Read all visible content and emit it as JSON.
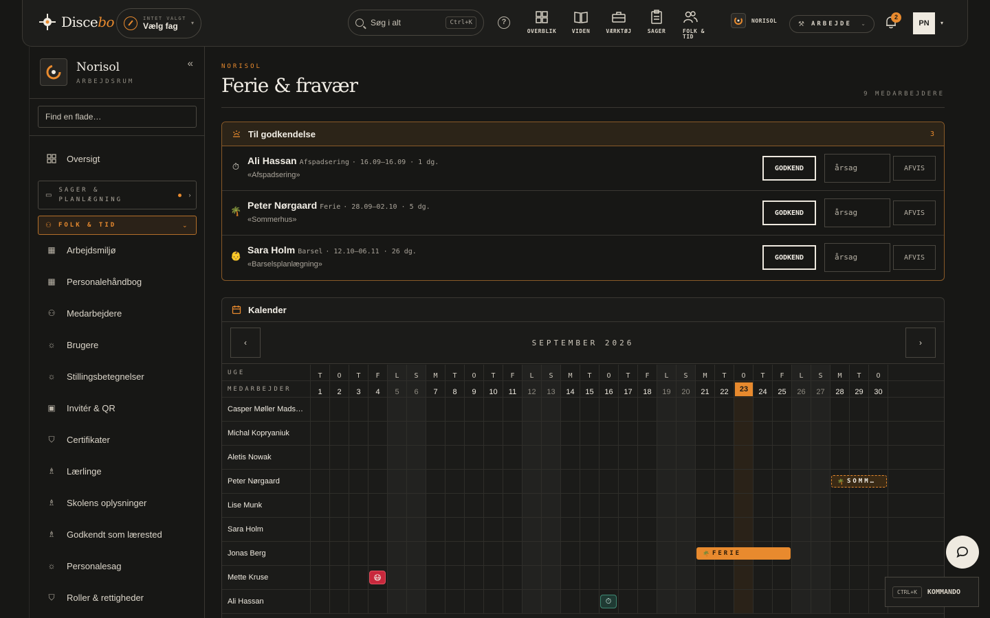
{
  "brand": {
    "name_a": "Disce",
    "name_b": "bo"
  },
  "fag_picker": {
    "eyebrow": "INTET VALGT",
    "label": "Vælg fag"
  },
  "search": {
    "placeholder": "Søg i alt",
    "shortcut": "Ctrl+K"
  },
  "nav": [
    {
      "label": "OVERBLIK",
      "icon": "grid-icon"
    },
    {
      "label": "VIDEN",
      "icon": "book-icon"
    },
    {
      "label": "VÆRKTØJ",
      "icon": "briefcase-icon"
    },
    {
      "label": "SAGER",
      "icon": "clipboard-icon"
    },
    {
      "label": "FOLK & TID",
      "icon": "people-icon"
    }
  ],
  "workspace_chip": "NORISOL",
  "role": "ARBEJDE",
  "notifications": "2",
  "user_initials": "PN",
  "sidebar": {
    "workspace": "Norisol",
    "workspace_sub": "ARBEJDSRUM",
    "find_placeholder": "Find en flade…",
    "overview": "Oversigt",
    "group_sager": "SAGER & PLANLÆGNING",
    "group_folk": "FOLK & TID",
    "items": [
      {
        "label": "Arbejdsmiljø",
        "icon": "grid-icon"
      },
      {
        "label": "Personalehåndbog",
        "icon": "grid-icon"
      },
      {
        "label": "Medarbejdere",
        "icon": "people-icon"
      },
      {
        "label": "Brugere",
        "icon": "sun-icon"
      },
      {
        "label": "Stillingsbetegnelser",
        "icon": "sun-icon"
      },
      {
        "label": "Invitér & QR",
        "icon": "qr-icon"
      },
      {
        "label": "Certifikater",
        "icon": "shield-icon"
      },
      {
        "label": "Lærlinge",
        "icon": "award-icon"
      },
      {
        "label": "Skolens oplysninger",
        "icon": "award-icon"
      },
      {
        "label": "Godkendt som lærested",
        "icon": "award-icon"
      },
      {
        "label": "Personalesag",
        "icon": "sun-icon"
      },
      {
        "label": "Roller & rettigheder",
        "icon": "shield-icon"
      }
    ]
  },
  "page": {
    "eyebrow": "NORISOL",
    "title": "Ferie & fravær",
    "count": "9 MEDARBEJDERE"
  },
  "approvals": {
    "title": "Til godkendelse",
    "count": "3",
    "approve_label": "GODKEND",
    "reason_placeholder": "årsag",
    "reject_label": "AFVIS",
    "requests": [
      {
        "name": "Ali Hassan",
        "type": "Afspadsering",
        "meta": "· 16.09–16.09 · 1 dg.",
        "note": "«Afspadsering»",
        "icon": "⏱"
      },
      {
        "name": "Peter Nørgaard",
        "type": "Ferie",
        "meta": "· 28.09–02.10 · 5 dg.",
        "note": "«Sommerhus»",
        "icon": "🌴"
      },
      {
        "name": "Sara Holm",
        "type": "Barsel",
        "meta": "· 12.10–06.11 · 26 dg.",
        "note": "«Barselsplanlægning»",
        "icon": "👶"
      }
    ]
  },
  "calendar": {
    "title": "Kalender",
    "month": "SEPTEMBER 2026",
    "week_label": "UGE",
    "employee_label": "MEDARBEJDER",
    "weekdays": [
      "T",
      "O",
      "T",
      "F",
      "L",
      "S",
      "M",
      "T",
      "O",
      "T",
      "F",
      "L",
      "S",
      "M",
      "T",
      "O",
      "T",
      "F",
      "L",
      "S",
      "M",
      "T",
      "O",
      "T",
      "F",
      "L",
      "S",
      "M",
      "T",
      "O"
    ],
    "days": [
      1,
      2,
      3,
      4,
      5,
      6,
      7,
      8,
      9,
      10,
      11,
      12,
      13,
      14,
      15,
      16,
      17,
      18,
      19,
      20,
      21,
      22,
      23,
      24,
      25,
      26,
      27,
      28,
      29,
      30
    ],
    "weekend_days": [
      5,
      6,
      12,
      13,
      19,
      20,
      26,
      27
    ],
    "today": 23,
    "employees": [
      "Casper Møller Mads…",
      "Michal Kopryaniuk",
      "Aletis Nowak",
      "Peter Nørgaard",
      "Lise Munk",
      "Sara Holm",
      "Jonas Berg",
      "Mette Kruse",
      "Ali Hassan"
    ],
    "events": [
      {
        "employee": 3,
        "start": 28,
        "end": 30,
        "label": "SOMM…",
        "kind": "pending",
        "icon": "🌴"
      },
      {
        "employee": 6,
        "start": 21,
        "end": 25,
        "label": "FERIE",
        "kind": "approved",
        "icon": "🌴"
      },
      {
        "employee": 7,
        "start": 4,
        "end": 4,
        "label": "",
        "kind": "sick",
        "icon": "😷"
      },
      {
        "employee": 8,
        "start": 16,
        "end": 16,
        "label": "",
        "kind": "comp",
        "icon": "⏱"
      }
    ]
  },
  "command": {
    "shortcut": "CTRL+K",
    "label": "KOMMANDO"
  },
  "colors": {
    "accent": "#e88a2e",
    "bg": "#171715",
    "sick": "#c8283c",
    "comp": "#1f3a33"
  }
}
